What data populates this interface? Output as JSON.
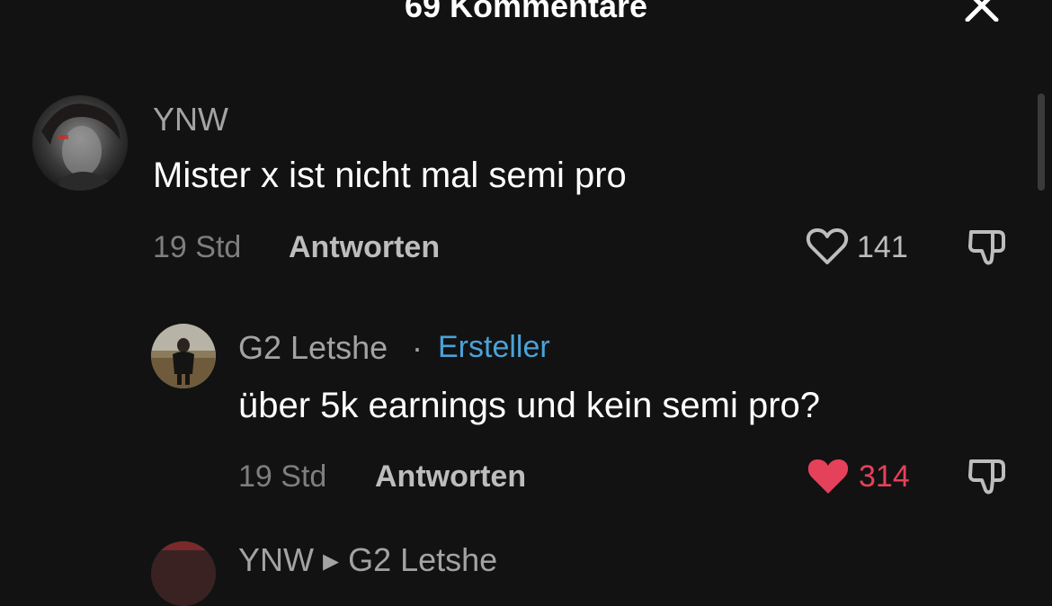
{
  "header": {
    "title": "69 Kommentare"
  },
  "colors": {
    "background": "#121212",
    "like_active": "#e5415b",
    "creator_badge": "#4aa3d8"
  },
  "comments": [
    {
      "username": "YNW",
      "text": "Mister x ist nicht mal semi pro",
      "time": "19 Std",
      "reply_label": "Antworten",
      "likes": "141",
      "liked": false
    }
  ],
  "replies": [
    {
      "username": "G2 Letshe",
      "separator": "·",
      "badge": "Ersteller",
      "text": "über 5k earnings und kein semi pro?",
      "time": "19 Std",
      "reply_label": "Antworten",
      "likes": "314",
      "liked": true
    },
    {
      "username": "YNW ▸ G2 Letshe"
    }
  ],
  "icons": {
    "close": "close-icon",
    "like": "heart-outline-icon",
    "liked": "heart-filled-icon",
    "dislike": "thumbs-down-icon"
  }
}
